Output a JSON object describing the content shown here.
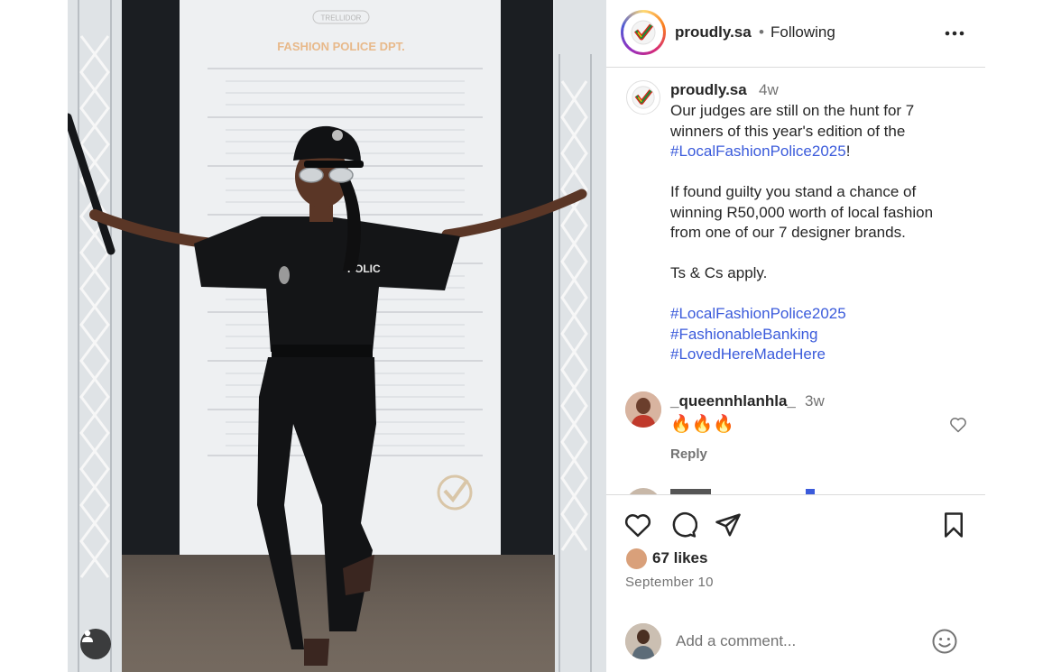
{
  "post": {
    "username": "proudly.sa",
    "separator": "•",
    "follow_status": "Following",
    "image_text": {
      "brand": "TRELLIDOR",
      "banner": "FASHION POLICE DPT.",
      "shirt_badge": "POLIC"
    }
  },
  "caption": {
    "username": "proudly.sa",
    "time": "4w",
    "lines": [
      {
        "text": "Our judges are still on the hunt for 7"
      },
      {
        "text": "winners of this year's edition of the"
      },
      {
        "hashtag": "#LocalFashionPolice2025",
        "suffix": "!"
      },
      {
        "blank": true
      },
      {
        "text": "If found guilty you stand a chance of"
      },
      {
        "text": "winning R50,000 worth of local fashion"
      },
      {
        "text": "from one of our  7 designer brands."
      },
      {
        "blank": true
      },
      {
        "text": "Ts & Cs apply."
      },
      {
        "blank": true
      },
      {
        "hashtag": "#LocalFashionPolice2025"
      },
      {
        "hashtag": "#FashionableBanking"
      },
      {
        "hashtag": "#LovedHereMadeHere"
      }
    ]
  },
  "comment": {
    "username": "_queennhlanhla_",
    "time": "3w",
    "text": "🔥🔥🔥",
    "reply_label": "Reply"
  },
  "actions": {
    "likes": "67 likes",
    "date": "September 10",
    "comment_placeholder": "Add a comment..."
  },
  "icons": {
    "more": "more-options-icon",
    "like": "heart-icon",
    "comment": "comment-bubble-icon",
    "share": "send-icon",
    "save": "bookmark-icon",
    "emoji": "emoji-icon",
    "user_tag": "user-tag-icon"
  },
  "colors": {
    "hashtag": "#3b5bdb",
    "muted": "#737373",
    "text": "#262626",
    "border": "#dbdbdb"
  }
}
